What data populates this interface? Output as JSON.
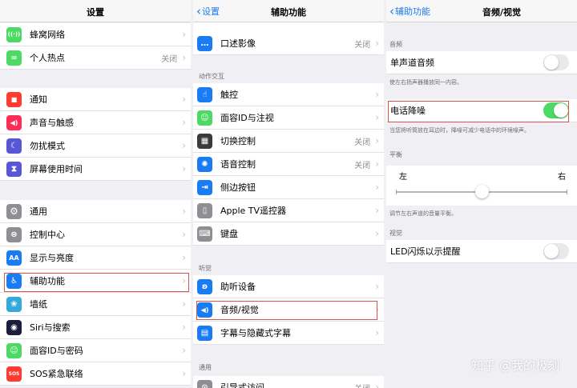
{
  "panel1": {
    "title": "设置",
    "items": [
      {
        "label": "蜂窝网络",
        "value": "",
        "icon": "cellular-icon",
        "glyph": "((·))",
        "color": "#4cd964"
      },
      {
        "label": "个人热点",
        "value": "关闭",
        "icon": "hotspot-icon",
        "glyph": "∞",
        "color": "#4cd964"
      },
      {
        "label": "通知",
        "value": "",
        "icon": "notification-icon",
        "glyph": "■",
        "color": "#ff3b30"
      },
      {
        "label": "声音与触感",
        "value": "",
        "icon": "speaker-icon",
        "glyph": "◀)",
        "color": "#ff2d55"
      },
      {
        "label": "勿扰模式",
        "value": "",
        "icon": "moon-icon",
        "glyph": "☾",
        "color": "#5856d6"
      },
      {
        "label": "屏幕使用时间",
        "value": "",
        "icon": "hourglass-icon",
        "glyph": "⧗",
        "color": "#5856d6"
      },
      {
        "label": "通用",
        "value": "",
        "icon": "gear-icon",
        "glyph": "⚙",
        "color": "#8e8e93"
      },
      {
        "label": "控制中心",
        "value": "",
        "icon": "control-center-icon",
        "glyph": "⊜",
        "color": "#8e8e93"
      },
      {
        "label": "显示与亮度",
        "value": "",
        "icon": "display-icon",
        "glyph": "AA",
        "color": "#1a7cf5"
      },
      {
        "label": "辅助功能",
        "value": "",
        "icon": "accessibility-icon",
        "glyph": "♿",
        "color": "#1a7cf5"
      },
      {
        "label": "墙纸",
        "value": "",
        "icon": "wallpaper-icon",
        "glyph": "❀",
        "color": "#34aadc"
      },
      {
        "label": "Siri与搜索",
        "value": "",
        "icon": "siri-icon",
        "glyph": "◉",
        "color": "#1c1c3c"
      },
      {
        "label": "面容ID与密码",
        "value": "",
        "icon": "face-id-icon",
        "glyph": "☺",
        "color": "#4cd964"
      },
      {
        "label": "SOS紧急联络",
        "value": "",
        "icon": "sos-icon",
        "glyph": "SOS",
        "color": "#ff3b30"
      }
    ]
  },
  "panel2": {
    "back": "设置",
    "title": "辅助功能",
    "items": [
      {
        "label": "口述影像",
        "value": "关闭",
        "icon": "speech-bubble-icon",
        "glyph": "…",
        "color": "#1a7cf5"
      },
      {
        "label": "触控",
        "value": "",
        "icon": "touch-hand-icon",
        "glyph": "☝",
        "color": "#1a7cf5"
      },
      {
        "label": "面容ID与注视",
        "value": "",
        "icon": "face-id-icon",
        "glyph": "☺",
        "color": "#4cd964"
      },
      {
        "label": "切换控制",
        "value": "关闭",
        "icon": "switch-control-icon",
        "glyph": "▦",
        "color": "#3a3a3c"
      },
      {
        "label": "语音控制",
        "value": "关闭",
        "icon": "voice-control-icon",
        "glyph": "✺",
        "color": "#1a7cf5"
      },
      {
        "label": "侧边按钮",
        "value": "",
        "icon": "side-button-icon",
        "glyph": "⇥",
        "color": "#1a7cf5"
      },
      {
        "label": "Apple TV遥控器",
        "value": "",
        "icon": "remote-icon",
        "glyph": "▯",
        "color": "#8e8e93"
      },
      {
        "label": "键盘",
        "value": "",
        "icon": "keyboard-icon",
        "glyph": "⌨",
        "color": "#8e8e93"
      },
      {
        "label": "助听设备",
        "value": "",
        "icon": "ear-icon",
        "glyph": "ʚ",
        "color": "#1a7cf5"
      },
      {
        "label": "音频/视觉",
        "value": "",
        "icon": "audio-visual-icon",
        "glyph": "◀)",
        "color": "#1a7cf5"
      },
      {
        "label": "字幕与隐藏式字幕",
        "value": "",
        "icon": "caption-icon",
        "glyph": "▤",
        "color": "#1a7cf5"
      },
      {
        "label": "引导式访问",
        "value": "关闭",
        "icon": "guided-access-icon",
        "glyph": "⊙",
        "color": "#8e8e93"
      }
    ],
    "sections": {
      "interaction": "动作交互",
      "hearing": "听觉",
      "general": "通用"
    }
  },
  "panel3": {
    "back": "辅助功能",
    "title": "音频/视觉",
    "sections": {
      "audio": "音频",
      "balance": "平衡",
      "visual": "视觉"
    },
    "mono": {
      "label": "单声道音频",
      "on": false,
      "note": "使左右扬声器播放同一内容。"
    },
    "noise": {
      "label": "电话降噪",
      "on": true,
      "note": "当您将听筒放在耳边时，降噪可减少电话中的环境噪声。"
    },
    "balance": {
      "left": "左",
      "right": "右",
      "value": 0.5,
      "note": "调节左右声道的音量平衡。"
    },
    "led": {
      "label": "LED闪烁以示提醒",
      "on": false
    }
  },
  "watermark": "知乎 @我的极刻"
}
